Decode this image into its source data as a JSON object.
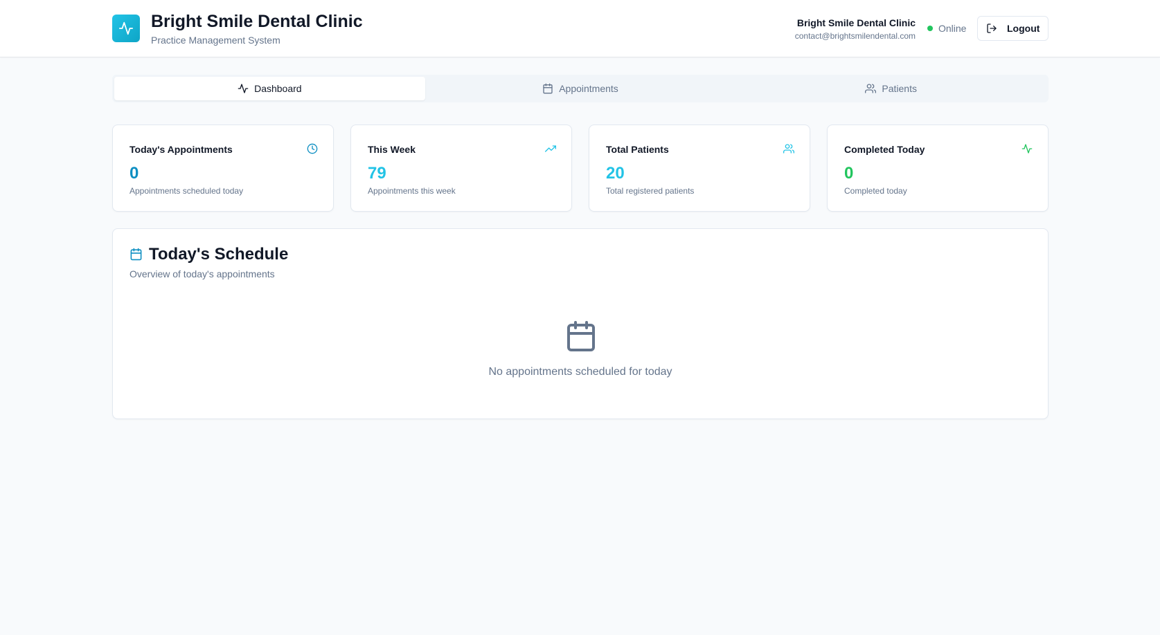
{
  "header": {
    "title": "Bright Smile Dental Clinic",
    "subtitle": "Practice Management System",
    "user_name": "Bright Smile Dental Clinic",
    "user_email": "contact@brightsmilendental.com",
    "status": "Online",
    "logout_label": "Logout"
  },
  "tabs": [
    {
      "label": "Dashboard",
      "icon": "activity-icon",
      "active": true
    },
    {
      "label": "Appointments",
      "icon": "calendar-icon",
      "active": false
    },
    {
      "label": "Patients",
      "icon": "users-icon",
      "active": false
    }
  ],
  "stats": [
    {
      "title": "Today's Appointments",
      "value": "0",
      "desc": "Appointments scheduled today",
      "icon": "clock-icon",
      "color": "#0e8fc2"
    },
    {
      "title": "This Week",
      "value": "79",
      "desc": "Appointments this week",
      "icon": "trending-up-icon",
      "color": "#22c3e6"
    },
    {
      "title": "Total Patients",
      "value": "20",
      "desc": "Total registered patients",
      "icon": "users-icon",
      "color": "#22c3e6"
    },
    {
      "title": "Completed Today",
      "value": "0",
      "desc": "Completed today",
      "icon": "activity-icon",
      "color": "#22c55e"
    }
  ],
  "schedule": {
    "title": "Today's Schedule",
    "subtitle": "Overview of today's appointments",
    "empty_text": "No appointments scheduled for today"
  },
  "colors": {
    "brand": "#22c3e6",
    "success": "#22c55e",
    "primary_dark": "#0e8fc2"
  }
}
